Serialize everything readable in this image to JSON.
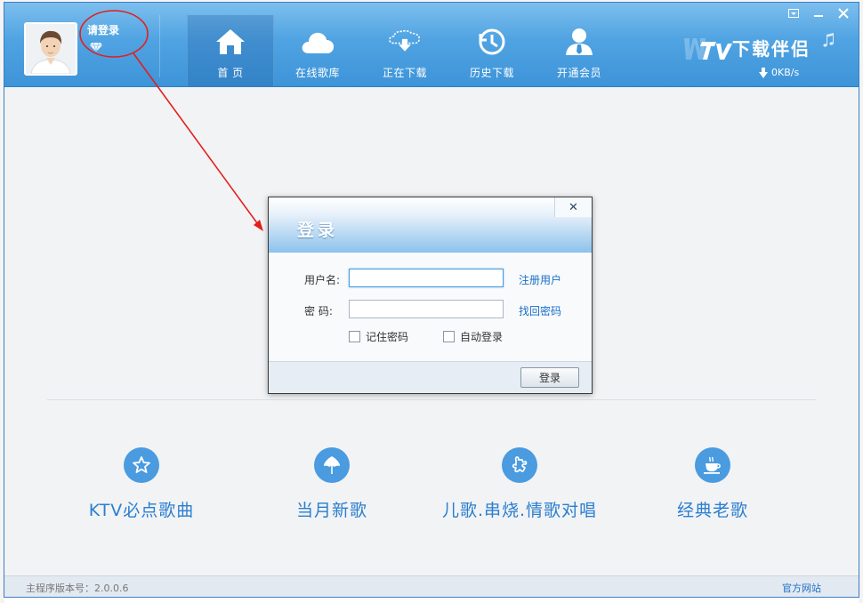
{
  "header": {
    "login_prompt": "请登录",
    "nav": [
      {
        "label": "首  页",
        "icon": "home-icon",
        "active": true
      },
      {
        "label": "在线歌库",
        "icon": "cloud-icon"
      },
      {
        "label": "正在下载",
        "icon": "cloud-download-icon"
      },
      {
        "label": "历史下载",
        "icon": "history-icon"
      },
      {
        "label": "开通会员",
        "icon": "member-icon"
      }
    ],
    "brand": "下载伴侣",
    "speed": "0KB/s",
    "window_controls": [
      "menu-icon",
      "minimize-icon",
      "close-icon"
    ]
  },
  "categories": [
    {
      "label": "KTV必点歌曲",
      "icon": "star-icon"
    },
    {
      "label": "当月新歌",
      "icon": "leaf-icon"
    },
    {
      "label": "儿歌.串烧.情歌对唱",
      "icon": "puzzle-icon"
    },
    {
      "label": "经典老歌",
      "icon": "cup-icon"
    }
  ],
  "status_bar": {
    "version": "主程序版本号：2.0.0.6",
    "official_site": "官方网站"
  },
  "login_dialog": {
    "title": "登录",
    "close": "✕",
    "username_label": "用户名:",
    "username_value": "",
    "password_label": "密  码:",
    "password_value": "",
    "register_link": "注册用户",
    "recover_link": "找回密码",
    "remember_password": "记住密码",
    "auto_login": "自动登录",
    "submit": "登录"
  },
  "colors": {
    "header_top": "#60b0ea",
    "header_bottom": "#3d94d8",
    "accent": "#2a7fcf",
    "annotation": "#e41e1e"
  }
}
